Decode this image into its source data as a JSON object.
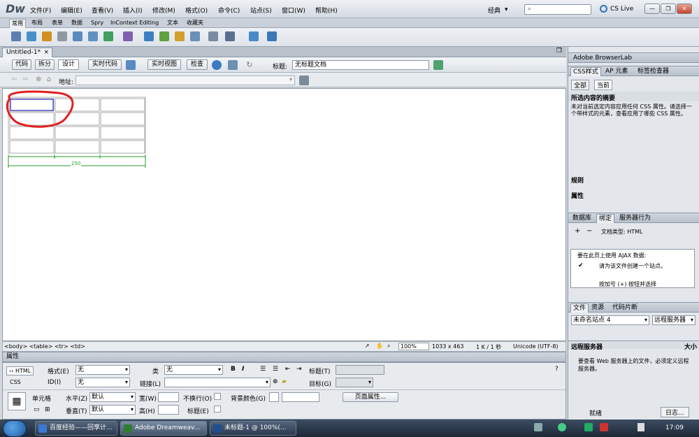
{
  "menubar": {
    "logo": "Dw",
    "items": [
      "文件(F)",
      "编辑(E)",
      "查看(V)",
      "插入(I)",
      "修改(M)",
      "格式(O)",
      "命令(C)",
      "站点(S)",
      "窗口(W)",
      "帮助(H)"
    ],
    "workspace": "经典",
    "cslive": "CS Live"
  },
  "insert_tabs": [
    "常用",
    "布局",
    "表单",
    "数据",
    "Spry",
    "InContext Editing",
    "文本",
    "收藏夹"
  ],
  "document": {
    "tab_name": "Untitled-1*",
    "views": {
      "code": "代码",
      "split": "拆分",
      "design": "设计",
      "live_code": "实时代码",
      "live_view": "实时视图",
      "inspect": "检查"
    },
    "title_label": "标题:",
    "title_value": "无标题文档",
    "address_label": "地址:",
    "table_width_label": "250"
  },
  "tag_bar": {
    "path": "<body> <table> <tr> <td>",
    "zoom": "100%",
    "size": "1033 x 463",
    "weight": "1 K / 1 秒",
    "encoding": "Unicode (UTF-8)"
  },
  "properties": {
    "header": "属性",
    "html": "HTML",
    "css": "CSS",
    "format_label": "格式(E)",
    "format_value": "无",
    "class_label": "类",
    "class_value": "无",
    "id_label": "ID(I)",
    "id_value": "无",
    "link_label": "链接(L)",
    "title_label": "标题(T)",
    "target_label": "目标(G)",
    "cell_label": "单元格",
    "horz_label": "水平(Z)",
    "horz_value": "默认",
    "vert_label": "垂直(T)",
    "vert_value": "默认",
    "width_label": "宽(W)",
    "height_label": "高(H)",
    "nowrap_label": "不换行(O)",
    "header_label": "标题(E)",
    "bg_label": "背景颜色(G)",
    "page_props": "页面属性..."
  },
  "right_panel": {
    "browserlab": "Adobe BrowserLab",
    "css_tabs": [
      "CSS样式",
      "AP 元素",
      "标签检查器"
    ],
    "css_subtabs": [
      "全部",
      "当前"
    ],
    "summary_title": "所选内容的摘要",
    "summary_text": "未对当前选定内容应用任何 CSS 属性。请选择一个带样式的元素，查看应用了哪些 CSS 属性。",
    "rules_label": "规则",
    "props_label": "属性",
    "bind_tabs": [
      "数据库",
      "绑定",
      "服务器行为"
    ],
    "doctype": "文档类型: HTML",
    "ajax_text": "要在此页上使用 AJAX 数据:",
    "ajax_step1": "请为该文件创建一个站点。",
    "ajax_step2": "按加号 (+) 按钮并选择",
    "file_tabs": [
      "文件",
      "资源",
      "代码片断"
    ],
    "site": "未命名站点 4",
    "view": "远程服务器",
    "remote_header": "远程服务器",
    "remote_header_right": "大小",
    "remote_text": "要查看 Web 服务器上的文件，必须定义远程服务器。",
    "ready": "就绪",
    "log": "日志..."
  },
  "taskbar": {
    "tasks": [
      "百度经验——回享计...",
      "Adobe Dreamweav...",
      "未标题-1 @ 100%(..."
    ],
    "time": "17:09"
  },
  "colors": {
    "selection": "#e02020",
    "accent": "#1a5fb4",
    "taskbar": "#2c3a4d"
  }
}
